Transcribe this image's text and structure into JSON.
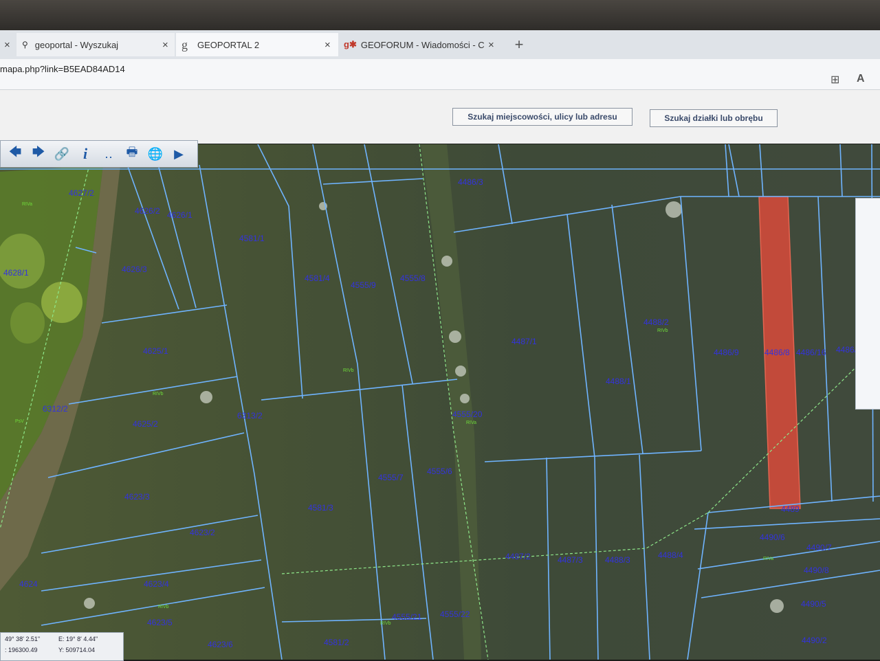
{
  "browser": {
    "tabs": [
      {
        "label": "",
        "close": "×"
      },
      {
        "label": "geoportal - Wyszukaj",
        "close": "×",
        "icon": "search-icon"
      },
      {
        "label": "GEOPORTAL 2",
        "close": "×",
        "icon": "g-letter-icon"
      },
      {
        "label": "GEOFORUM - Wiadomości - Czyn",
        "close": "×",
        "icon": "geoforum-logo-icon"
      }
    ],
    "new_tab": "+",
    "url": "mapa.php?link=B5EAD84AD14",
    "reader_icon": "A",
    "add_tab_icon": "⊞"
  },
  "header": {
    "search_address": "Szukaj miejscowości, ulicy lub adresu",
    "search_parcel": "Szukaj działki lub obrębu"
  },
  "toolbar": {
    "icons": [
      "back-arrow-icon",
      "forward-arrow-icon",
      "link-icon",
      "info-icon",
      "measure-icon",
      "print-icon",
      "globe-icon",
      "camera-icon"
    ],
    "glyphs": [
      "🡄",
      "🡆",
      "🔗",
      "i",
      "‥",
      "🖶",
      "🌐",
      "▶"
    ]
  },
  "parcels": [
    "4627/2",
    "4626/2",
    "4626/1",
    "4628/1",
    "4626/3",
    "4581/1",
    "4581/4",
    "4555/9",
    "4555/8",
    "4486/3",
    "4487/1",
    "4488/2",
    "4486/9",
    "4486/8",
    "4486/16",
    "4486/",
    "4625/1",
    "4488/1",
    "6312/2",
    "6313/2",
    "4625/2",
    "4555/20",
    "4555/7",
    "4555/6",
    "4623/3",
    "4581/3",
    "4489",
    "4490/6",
    "4490/7",
    "4623/2",
    "4487/2",
    "4487/3",
    "4488/3",
    "4488/4",
    "4490/8",
    "4623/4",
    "4490/5",
    "4623/5",
    "4555/21",
    "4555/22",
    "4581/2",
    "4623/6",
    "4490/2",
    "4624"
  ],
  "land_use": [
    "RIVa",
    "RIVb",
    "RIVb",
    "RIVb",
    "PsV",
    "RIVa",
    "RIVb",
    "RIVa",
    "RIVb"
  ],
  "coords": {
    "lat": "49° 38' 2.51\"",
    "lon": "E: 19° 8' 4.44\"",
    "x": ": 196300.49",
    "y": "Y: 509714.04"
  },
  "colors": {
    "parcel_line": "#6fb4ff",
    "parcel_label": "#3333dd",
    "highlight": "#d94b3a",
    "land_use_label": "#6fdc3a"
  }
}
